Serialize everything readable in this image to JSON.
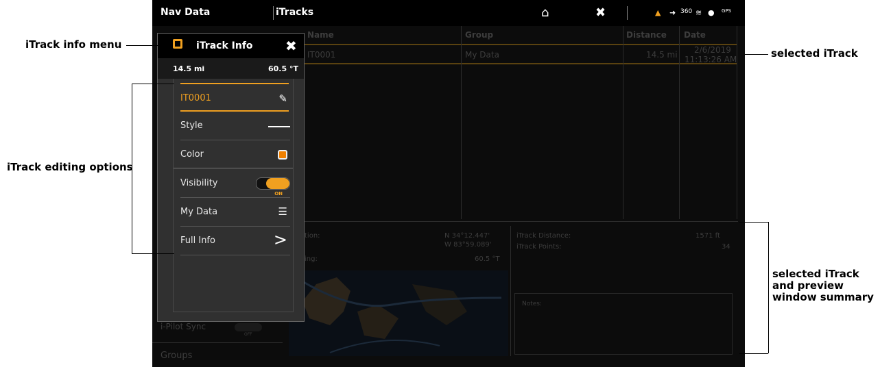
{
  "topbar": {
    "left_title": "Nav Data",
    "center_title": "iTracks",
    "home_icon": "home-icon",
    "close_icon": "close-icon",
    "status_icons": [
      "gps-icon",
      "autopilot-icon",
      "360-icon",
      "sonar-icon",
      "compass-icon",
      "gps-signal-icon"
    ],
    "status_360_label": "360",
    "status_gps_label": "GPS"
  },
  "table": {
    "headers": [
      "Name",
      "Group",
      "Distance",
      "Date"
    ],
    "row": {
      "name": "IT0001",
      "group": "My Data",
      "distance": "14.5 mi",
      "date": "2/6/2019",
      "time": "11:13:26 AM"
    }
  },
  "summary": {
    "position_label": "tion:",
    "position_value_lat": "N 34°12.447'",
    "position_value_lon": "W 83°59.089'",
    "bearing_label": "ing:",
    "bearing_value": "60.5 °T",
    "itrack_distance_label": "iTrack Distance:",
    "itrack_distance_value": "1571 ft",
    "itrack_points_label": "iTrack Points:",
    "itrack_points_value": "34",
    "notes_label": "Notes:"
  },
  "sidebar_dim": {
    "ipilot_sync": "i-Pilot Sync",
    "toggle_off": "OFF",
    "groups": "Groups"
  },
  "panel": {
    "title": "iTrack Info",
    "distance": "14.5 mi",
    "bearing": "60.5 °T",
    "name": "IT0001",
    "style_label": "Style",
    "color_label": "Color",
    "visibility_label": "Visibility",
    "visibility_state": "ON",
    "group_label": "My Data",
    "full_info_label": "Full Info",
    "full_info_arrow": ">",
    "color_value": "#f08000"
  },
  "callouts": {
    "info_menu": "iTrack info menu",
    "editing_options": "iTrack editing options",
    "selected": "selected iTrack",
    "summary_l1": "selected iTrack",
    "summary_l2": "and preview",
    "summary_l3": "window summary"
  },
  "colors": {
    "accent": "#f0a020",
    "background": "#0c0c0c"
  }
}
